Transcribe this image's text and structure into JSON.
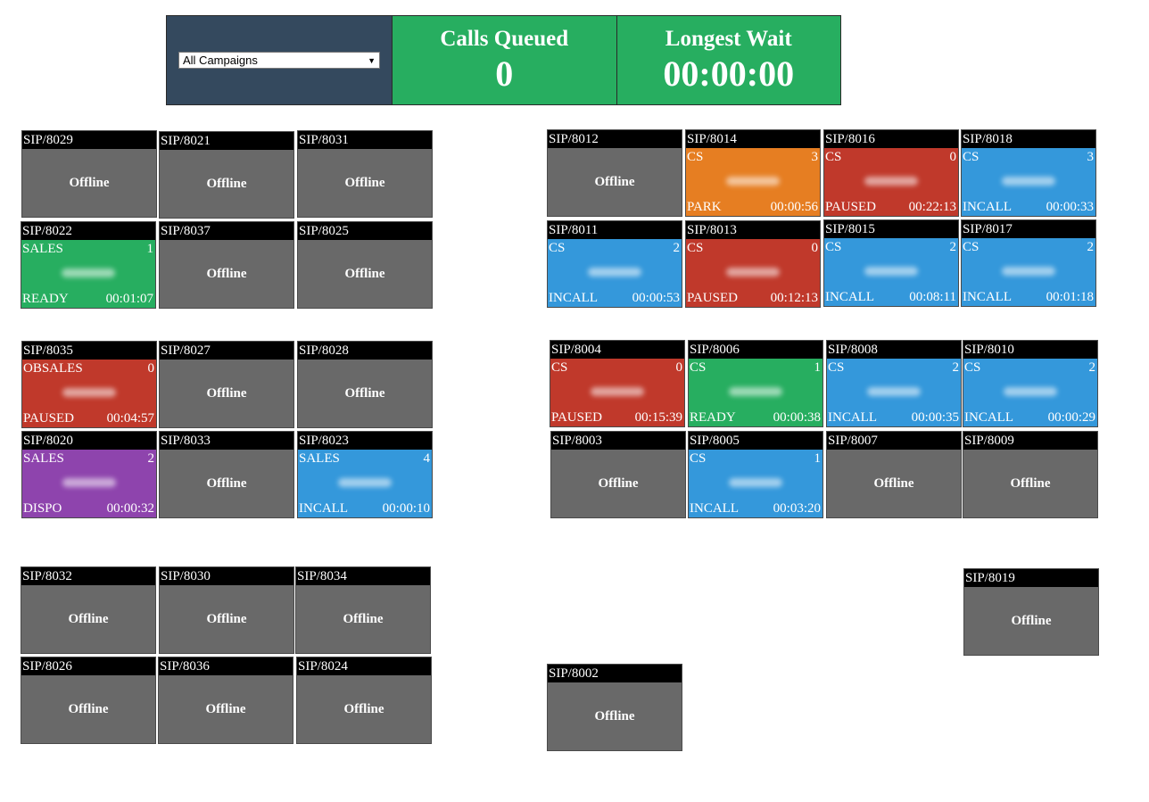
{
  "header": {
    "campaign_select": "All Campaigns",
    "calls_queued_label": "Calls Queued",
    "calls_queued_value": "0",
    "longest_wait_label": "Longest Wait",
    "longest_wait_value": "00:00:00"
  },
  "colors": {
    "header_bg": "#34495e",
    "stat_bg": "#27ae60",
    "offline": "#696969",
    "ready": "#27ae60",
    "paused": "#c0392b",
    "incall": "#3498db",
    "park": "#e67e22",
    "dispo": "#8e44ad"
  },
  "tiles": [
    {
      "id": "SIP/8029",
      "status": "offline",
      "label": "Offline"
    },
    {
      "id": "SIP/8021",
      "status": "offline",
      "label": "Offline"
    },
    {
      "id": "SIP/8031",
      "status": "offline",
      "label": "Offline"
    },
    {
      "id": "SIP/8022",
      "status": "ready",
      "campaign": "SALES",
      "calls": "1",
      "state": "READY",
      "time": "00:01:07"
    },
    {
      "id": "SIP/8037",
      "status": "offline",
      "label": "Offline"
    },
    {
      "id": "SIP/8025",
      "status": "offline",
      "label": "Offline"
    },
    {
      "id": "SIP/8035",
      "status": "paused",
      "campaign": "OBSALES",
      "calls": "0",
      "state": "PAUSED",
      "time": "00:04:57"
    },
    {
      "id": "SIP/8027",
      "status": "offline",
      "label": "Offline"
    },
    {
      "id": "SIP/8028",
      "status": "offline",
      "label": "Offline"
    },
    {
      "id": "SIP/8020",
      "status": "dispo",
      "campaign": "SALES",
      "calls": "2",
      "state": "DISPO",
      "time": "00:00:32"
    },
    {
      "id": "SIP/8033",
      "status": "offline",
      "label": "Offline"
    },
    {
      "id": "SIP/8023",
      "status": "incall",
      "campaign": "SALES",
      "calls": "4",
      "state": "INCALL",
      "time": "00:00:10"
    },
    {
      "id": "SIP/8032",
      "status": "offline",
      "label": "Offline"
    },
    {
      "id": "SIP/8030",
      "status": "offline",
      "label": "Offline"
    },
    {
      "id": "SIP/8034",
      "status": "offline",
      "label": "Offline"
    },
    {
      "id": "SIP/8026",
      "status": "offline",
      "label": "Offline"
    },
    {
      "id": "SIP/8036",
      "status": "offline",
      "label": "Offline"
    },
    {
      "id": "SIP/8024",
      "status": "offline",
      "label": "Offline"
    },
    {
      "id": "SIP/8012",
      "status": "offline",
      "label": "Offline"
    },
    {
      "id": "SIP/8014",
      "status": "park",
      "campaign": "CS",
      "calls": "3",
      "state": "PARK",
      "time": "00:00:56"
    },
    {
      "id": "SIP/8016",
      "status": "paused",
      "campaign": "CS",
      "calls": "0",
      "state": "PAUSED",
      "time": "00:22:13"
    },
    {
      "id": "SIP/8018",
      "status": "incall",
      "campaign": "CS",
      "calls": "3",
      "state": "INCALL",
      "time": "00:00:33"
    },
    {
      "id": "SIP/8011",
      "status": "incall",
      "campaign": "CS",
      "calls": "2",
      "state": "INCALL",
      "time": "00:00:53"
    },
    {
      "id": "SIP/8013",
      "status": "paused",
      "campaign": "CS",
      "calls": "0",
      "state": "PAUSED",
      "time": "00:12:13"
    },
    {
      "id": "SIP/8015",
      "status": "incall",
      "campaign": "CS",
      "calls": "2",
      "state": "INCALL",
      "time": "00:08:11"
    },
    {
      "id": "SIP/8017",
      "status": "incall",
      "campaign": "CS",
      "calls": "2",
      "state": "INCALL",
      "time": "00:01:18"
    },
    {
      "id": "SIP/8004",
      "status": "paused",
      "campaign": "CS",
      "calls": "0",
      "state": "PAUSED",
      "time": "00:15:39"
    },
    {
      "id": "SIP/8006",
      "status": "ready",
      "campaign": "CS",
      "calls": "1",
      "state": "READY",
      "time": "00:00:38"
    },
    {
      "id": "SIP/8008",
      "status": "incall",
      "campaign": "CS",
      "calls": "2",
      "state": "INCALL",
      "time": "00:00:35"
    },
    {
      "id": "SIP/8010",
      "status": "incall",
      "campaign": "CS",
      "calls": "2",
      "state": "INCALL",
      "time": "00:00:29"
    },
    {
      "id": "SIP/8003",
      "status": "offline",
      "label": "Offline"
    },
    {
      "id": "SIP/8005",
      "status": "incall",
      "campaign": "CS",
      "calls": "1",
      "state": "INCALL",
      "time": "00:03:20"
    },
    {
      "id": "SIP/8007",
      "status": "offline",
      "label": "Offline"
    },
    {
      "id": "SIP/8009",
      "status": "offline",
      "label": "Offline"
    },
    {
      "id": "SIP/8019",
      "status": "offline",
      "label": "Offline"
    },
    {
      "id": "SIP/8002",
      "status": "offline",
      "label": "Offline"
    }
  ]
}
